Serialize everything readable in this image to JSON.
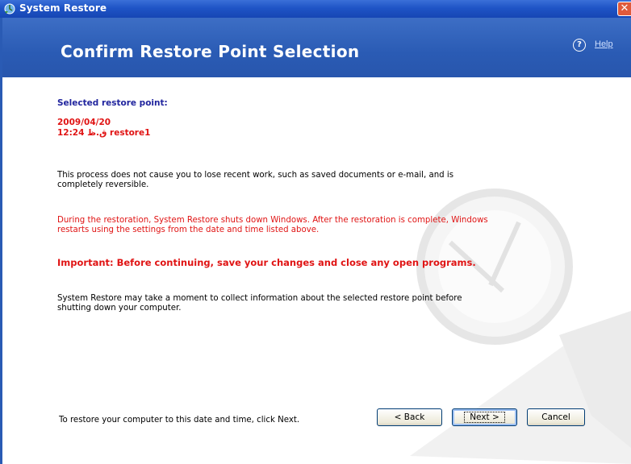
{
  "window": {
    "title": "System Restore",
    "close_glyph": "✕"
  },
  "header": {
    "title": "Confirm Restore Point Selection",
    "help_label": "Help"
  },
  "selected_point": {
    "label": "Selected restore point:",
    "date": "2009/04/20",
    "time_name": "12:24 ق.ظ restore1"
  },
  "paragraphs": {
    "reversible": "This process does not cause you to lose recent work, such as saved documents or e-mail, and is completely reversible.",
    "shutdown": "During the restoration, System Restore shuts down Windows. After the restoration is complete, Windows restarts using the settings from the date and time listed above.",
    "important": "Important: Before continuing, save your changes and close any open programs.",
    "moment": "System Restore may take a moment to collect information about the selected restore point before shutting down your computer."
  },
  "footer": {
    "instruction": "To restore your computer to this date and time, click Next.",
    "back_label": "< Back",
    "next_label": "Next >",
    "cancel_label": "Cancel"
  },
  "colors": {
    "header_blue": "#2a5bb4",
    "title_blue": "#21259e",
    "warning_red": "#e01414"
  },
  "icons": {
    "app": "system-restore-icon",
    "help": "help-icon",
    "close": "close-icon"
  }
}
